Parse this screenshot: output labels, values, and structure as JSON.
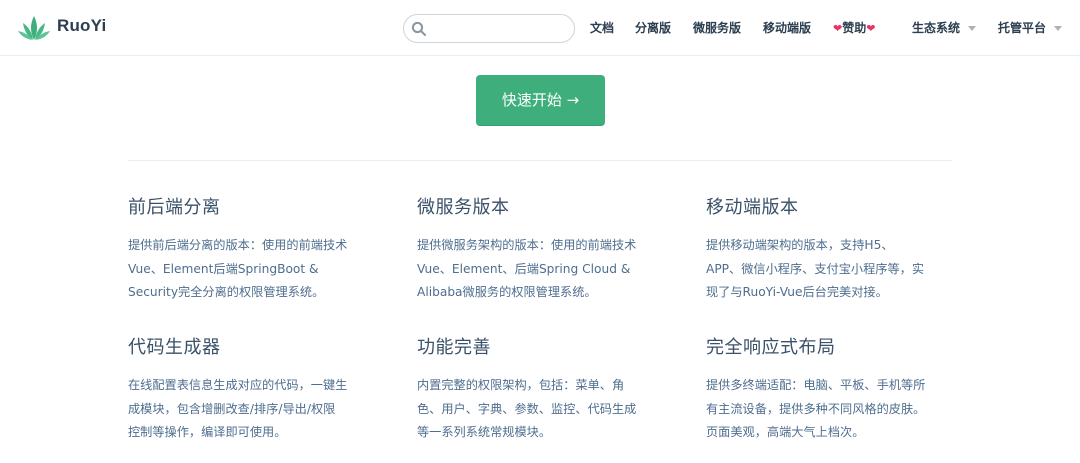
{
  "brand": {
    "name": "RuoYi",
    "accent": "#3eaf7c"
  },
  "search": {
    "placeholder": "",
    "value": ""
  },
  "nav": [
    {
      "label": "文档",
      "heart": false,
      "dropdown": false
    },
    {
      "label": "分离版",
      "heart": false,
      "dropdown": false
    },
    {
      "label": "微服务版",
      "heart": false,
      "dropdown": false
    },
    {
      "label": "移动端版",
      "heart": false,
      "dropdown": false
    },
    {
      "label": "赞助",
      "heart": true,
      "dropdown": false
    },
    {
      "label": "生态系统",
      "heart": false,
      "dropdown": true
    },
    {
      "label": "托管平台",
      "heart": false,
      "dropdown": true
    }
  ],
  "hero": {
    "action_label": "快速开始 →"
  },
  "features": [
    {
      "title": "前后端分离",
      "lines": [
        "提供前后端分离的版本：使用的前端技术",
        "Vue、Element后端SpringBoot &",
        "Security完全分离的权限管理系统。"
      ]
    },
    {
      "title": "微服务版本",
      "lines": [
        "提供微服务架构的版本：使用的前端技术",
        "Vue、Element、后端Spring Cloud &",
        "Alibaba微服务的权限管理系统。"
      ]
    },
    {
      "title": "移动端版本",
      "lines": [
        "提供移动端架构的版本，支持H5、",
        "APP、微信小程序、支付宝小程序等，实",
        "现了与RuoYi-Vue后台完美对接。"
      ]
    },
    {
      "title": "代码生成器",
      "lines": [
        "在线配置表信息生成对应的代码，一键生",
        "成模块，包含增删改查/排序/导出/权限",
        "控制等操作，编译即可使用。"
      ]
    },
    {
      "title": "功能完善",
      "lines": [
        "内置完整的权限架构，包括：菜单、角",
        "色、用户、字典、参数、监控、代码生成",
        "等一系列系统常规模块。"
      ]
    },
    {
      "title": "完全响应式布局",
      "lines": [
        "提供多终端适配：电脑、平板、手机等所",
        "有主流设备，提供多种不同风格的皮肤。",
        "页面美观，高端大气上档次。"
      ]
    }
  ]
}
